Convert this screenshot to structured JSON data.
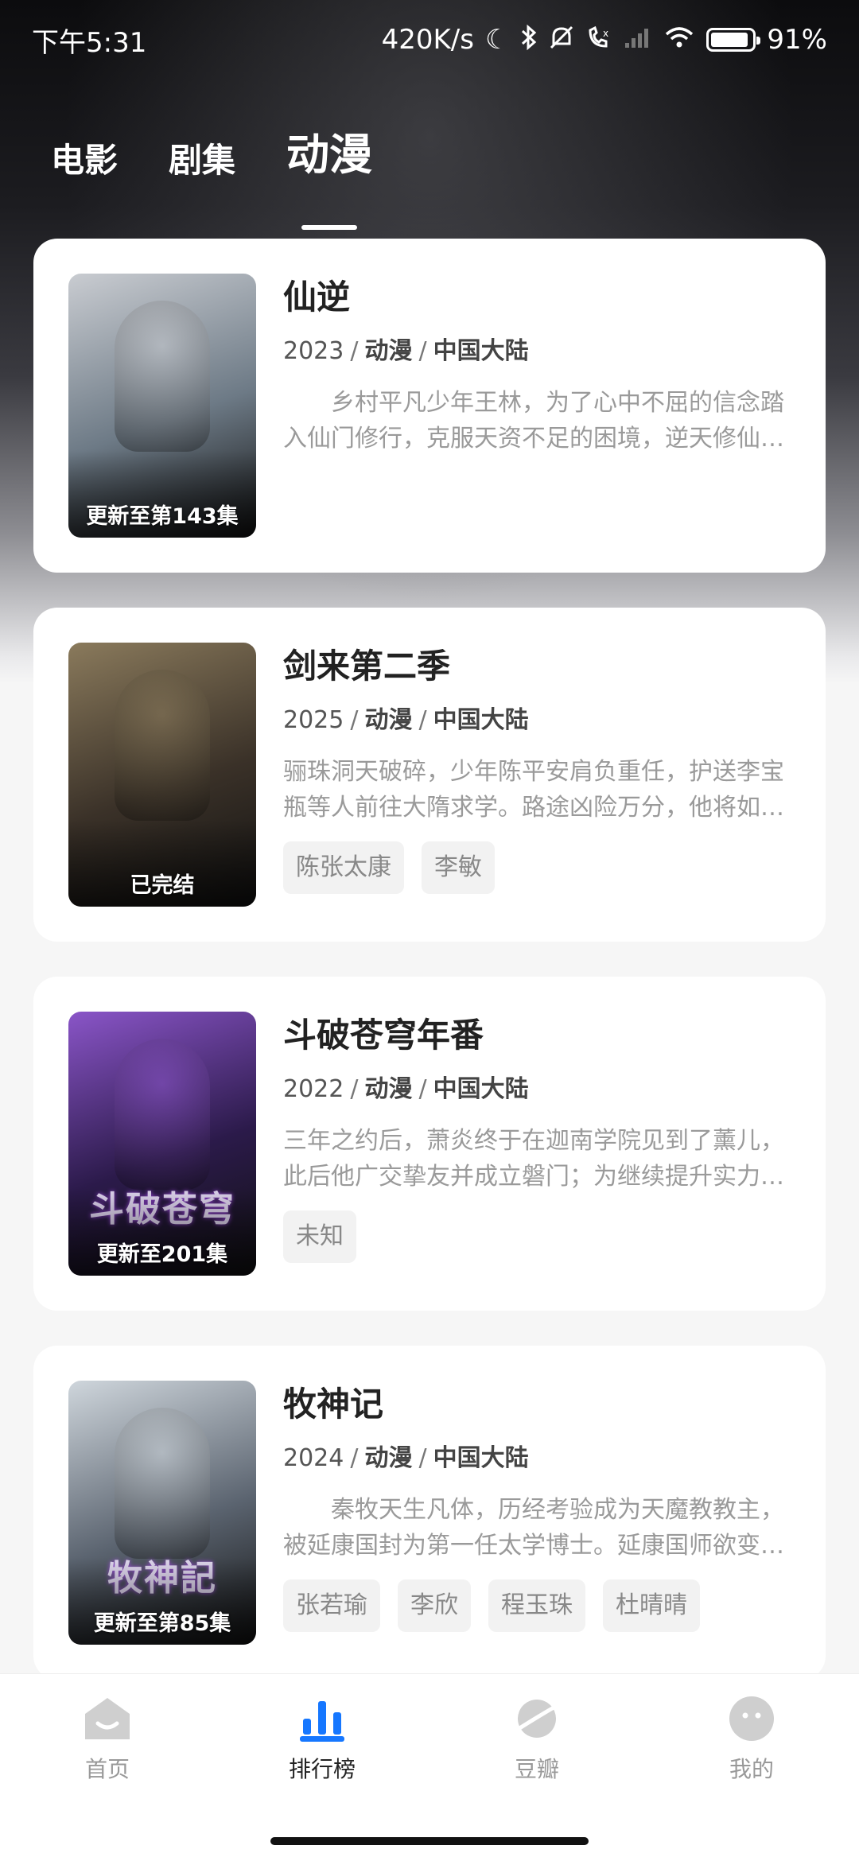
{
  "status_bar": {
    "time": "下午5:31",
    "network_speed": "420K/s",
    "battery_percent": "91%",
    "battery_level": 0.91,
    "icons": [
      "moon-icon",
      "bluetooth-icon",
      "bell-off-icon",
      "call-icon",
      "signal-icon",
      "wifi-icon",
      "battery-icon"
    ]
  },
  "tabs": [
    {
      "label": "电影",
      "active": false
    },
    {
      "label": "剧集",
      "active": false
    },
    {
      "label": "动漫",
      "active": true
    }
  ],
  "items": [
    {
      "title": "仙逆",
      "year": "2023",
      "genre": "动漫",
      "region": "中国大陆",
      "description": "乡村平凡少年王林，为了心中不屈的信念踏入仙门修行，克服天资不足的困境，逆天修仙之路由此开启。",
      "indent": true,
      "poster_caption": "更新至第143集",
      "poster_colors": [
        "#6d7a86",
        "#c9ccd1"
      ],
      "tags": []
    },
    {
      "title": "剑来第二季",
      "year": "2025",
      "genre": "动漫",
      "region": "中国大陆",
      "description": "骊珠洞天破碎，少年陈平安肩负重任，护送李宝瓶等人前往大隋求学。路途凶险万分，他将如何应对？",
      "indent": false,
      "poster_caption": "已完结",
      "poster_colors": [
        "#3a3128",
        "#8a7a5c"
      ],
      "tags": [
        "陈张太康",
        "李敏"
      ]
    },
    {
      "title": "斗破苍穹年番",
      "year": "2022",
      "genre": "动漫",
      "region": "中国大陆",
      "description": "三年之约后，萧炎终于在迦南学院见到了薰儿，此后他广交挚友并成立磐门；为继续提升实力，他再度启程。",
      "indent": false,
      "poster_caption": "更新至201集",
      "poster_calligraphy": "斗破苍穹",
      "poster_colors": [
        "#2b1a4a",
        "#8a55c8"
      ],
      "tags": [
        "未知"
      ]
    },
    {
      "title": "牧神记",
      "year": "2024",
      "genre": "动漫",
      "region": "中国大陆",
      "description": "秦牧天生凡体，历经考验成为天魔教教主，被延康国封为第一任太学博士。延康国师欲变法图强。",
      "indent": true,
      "poster_caption": "更新至第85集",
      "poster_calligraphy": "牧神記",
      "poster_colors": [
        "#5b6470",
        "#cfd6dc"
      ],
      "tags": [
        "张若瑜",
        "李欣",
        "程玉珠",
        "杜晴晴"
      ]
    }
  ],
  "bottom_nav": [
    {
      "label": "首页",
      "icon": "home-icon",
      "active": false
    },
    {
      "label": "排行榜",
      "icon": "ranking-icon",
      "active": true
    },
    {
      "label": "豆瓣",
      "icon": "planet-icon",
      "active": false
    },
    {
      "label": "我的",
      "icon": "profile-icon",
      "active": false
    }
  ],
  "accent_color": "#1677ff"
}
